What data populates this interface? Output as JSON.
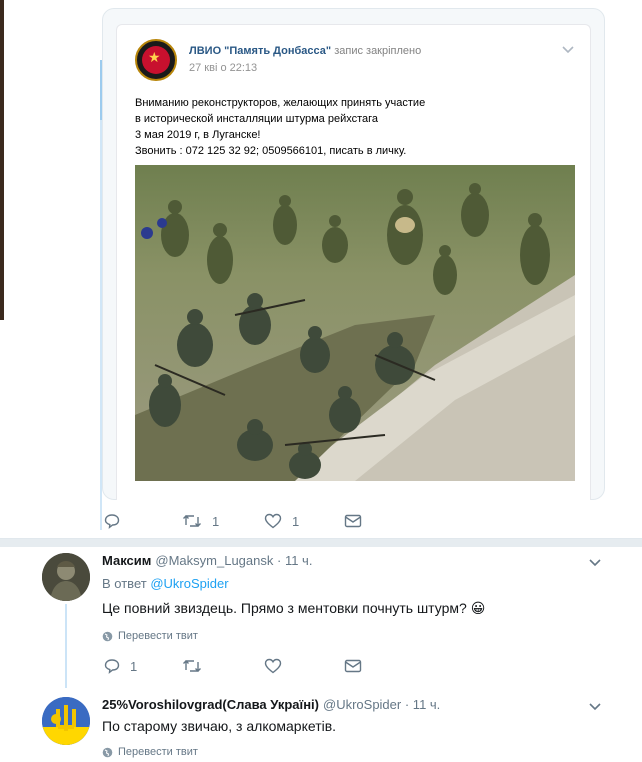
{
  "quoted_post": {
    "group_name": "ЛВИО \"Память Донбасса\"",
    "pinned_label": "запис закріплено",
    "date": "27 кві о 22:13",
    "text_lines": [
      "Вниманию реконструкторов, желающих принять участие",
      "в исторической инсталляции штурма рейхстага",
      "3 мая 2019 г, в Луганске!",
      "Звонить : 072 125 32 92; 0509566101, писать в личку."
    ],
    "photo_icon": "reenactment-battle-photo"
  },
  "main_tweet_actions": {
    "reply_count": "",
    "retweet_count": "1",
    "like_count": "1"
  },
  "replies": [
    {
      "name": "Максим",
      "handle": "@Maksym_Lugansk",
      "time": "· 11 ч.",
      "reply_prefix": "В ответ",
      "reply_to": "@UkroSpider",
      "text": "Це повний звиздець. Прямо з ментовки почнуть штурм?",
      "emoji": "😀",
      "translate": "Перевести твит",
      "reply_count": "1",
      "retweet_count": "",
      "like_count": ""
    },
    {
      "name": "25%Voroshilovgrad(Слава Україні)",
      "handle": "@UkroSpider",
      "time": "· 11 ч.",
      "text": "По старому звичаю, з алкомаркетів.",
      "translate": "Перевести твит"
    }
  ],
  "colors": {
    "accent": "#1da1f2",
    "vk_link": "#2a5885",
    "muted": "#657786",
    "divider": "#e6ecf0"
  }
}
